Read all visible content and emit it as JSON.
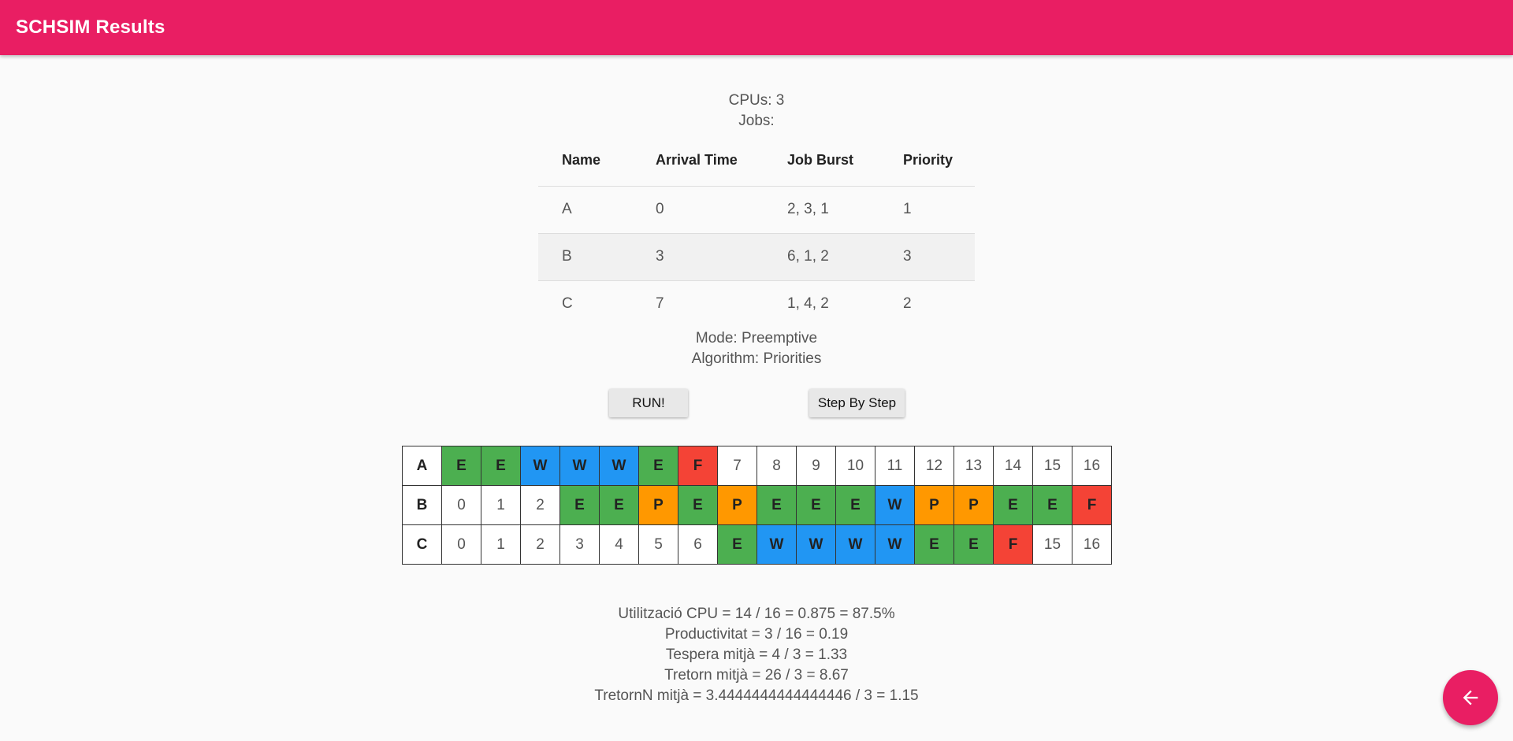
{
  "app": {
    "title": "SCHSIM Results"
  },
  "info": {
    "cpus": "CPUs: 3",
    "jobs_label": "Jobs:",
    "mode": "Mode: Preemptive",
    "algorithm": "Algorithm: Priorities"
  },
  "jobs_table": {
    "headers": [
      "Name",
      "Arrival Time",
      "Job Burst",
      "Priority"
    ],
    "rows": [
      [
        "A",
        "0",
        "2, 3, 1",
        "1"
      ],
      [
        "B",
        "3",
        "6, 1, 2",
        "3"
      ],
      [
        "C",
        "7",
        "1, 4, 2",
        "2"
      ]
    ]
  },
  "buttons": {
    "run": "RUN!",
    "step": "Step By Step"
  },
  "colors": {
    "E": "#4caf50",
    "W": "#2196f3",
    "P": "#ff9800",
    "F": "#f44336",
    "accent": "#e91e63"
  },
  "gantt": {
    "rows": [
      {
        "name": "A",
        "cells": [
          "E",
          "E",
          "W",
          "W",
          "W",
          "E",
          "F",
          "7",
          "8",
          "9",
          "10",
          "11",
          "12",
          "13",
          "14",
          "15",
          "16"
        ]
      },
      {
        "name": "B",
        "cells": [
          "0",
          "1",
          "2",
          "E",
          "E",
          "P",
          "E",
          "P",
          "E",
          "E",
          "E",
          "W",
          "P",
          "P",
          "E",
          "E",
          "F"
        ]
      },
      {
        "name": "C",
        "cells": [
          "0",
          "1",
          "2",
          "3",
          "4",
          "5",
          "6",
          "E",
          "W",
          "W",
          "W",
          "W",
          "E",
          "E",
          "F",
          "15",
          "16"
        ]
      }
    ]
  },
  "stats": [
    "Utilització CPU = 14 / 16 = 0.875 = 87.5%",
    "Productivitat = 3 / 16 = 0.19",
    "Tespera mitjà = 4 / 3 = 1.33",
    "Tretorn mitjà = 26 / 3 = 8.67",
    "TretornN mitjà = 3.4444444444444446 / 3 = 1.15"
  ],
  "fab": {
    "icon": "arrow-left-icon"
  }
}
